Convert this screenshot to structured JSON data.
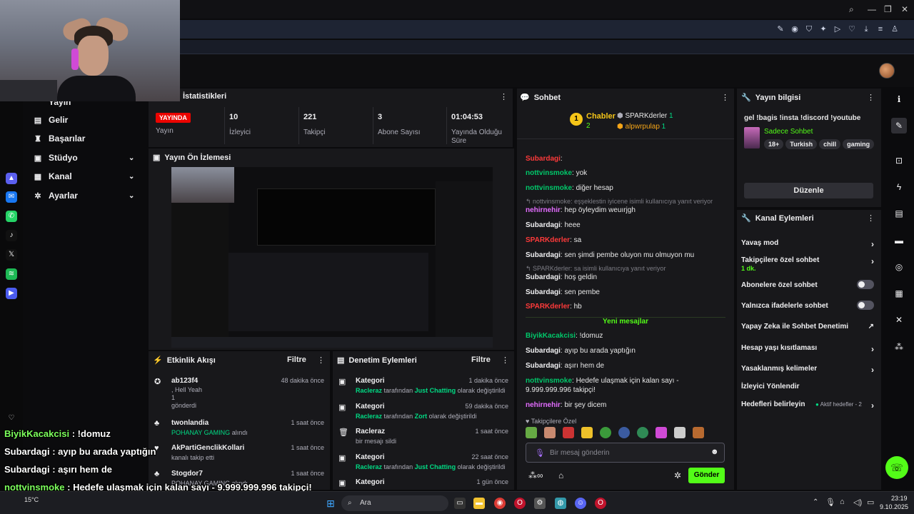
{
  "nav": {
    "current_partial": "Yayın",
    "items": [
      {
        "label": "Gelir",
        "icon": "dollar-icon",
        "chev": ""
      },
      {
        "label": "Başarılar",
        "icon": "trophy-icon",
        "chev": ""
      },
      {
        "label": "Stüdyo",
        "icon": "studio-icon",
        "chev": "⌄"
      },
      {
        "label": "Kanal",
        "icon": "channel-icon",
        "chev": "⌄"
      },
      {
        "label": "Ayarlar",
        "icon": "gear-icon",
        "chev": "⌄"
      }
    ]
  },
  "stats": {
    "title": "İstatistikleri",
    "live_badge": "YAYINDA",
    "live_label": "Yayın",
    "viewers": {
      "value": "10",
      "label": "İzleyici"
    },
    "followers": {
      "value": "221",
      "label": "Takipçi"
    },
    "subs": {
      "value": "3",
      "label": "Abone Sayısı"
    },
    "uptime": {
      "value": "01:04:53",
      "label": "Yayında Olduğu Süre"
    }
  },
  "preview": {
    "title": "Yayın Ön İzlemesi"
  },
  "activity": {
    "title": "Etkinlik Akışı",
    "filter": "Filtre",
    "items": [
      {
        "name": "ab123f4",
        "time": "48 dakika önce",
        "line1": ", Hell Yeah",
        "line2": "1",
        "line3": "gönderdi"
      },
      {
        "name": "twonlandia",
        "time": "1 saat önce",
        "line1": "POHANAY GAMING",
        "line2": "alındı"
      },
      {
        "name": "AkPartiGenclikKollari",
        "time": "1 saat önce",
        "line1": "kanalı takip etti"
      },
      {
        "name": "Stogdor7",
        "time": "1 saat önce",
        "line1": "POHANAY GAMING alındı"
      }
    ]
  },
  "mod": {
    "title": "Denetim Eylemleri",
    "filter": "Filtre",
    "items": [
      {
        "title": "Kategori",
        "time": "1 dakika önce",
        "who": "Racleraz",
        "mid": "tarafından",
        "what": "Just Chatting",
        "end": "olarak değiştirildi"
      },
      {
        "title": "Kategori",
        "time": "59 dakika önce",
        "who": "Racleraz",
        "mid": "tarafından",
        "what": "Zort",
        "end": "olarak değiştirildi"
      },
      {
        "title": "Racleraz",
        "time": "1 saat önce",
        "who": "",
        "mid": "bir mesajı sildi",
        "what": "",
        "end": ""
      },
      {
        "title": "Kategori",
        "time": "22 saat önce",
        "who": "Racleraz",
        "mid": "tarafından",
        "what": "Just Chatting",
        "end": "olarak değiştirildi"
      },
      {
        "title": "Kategori",
        "time": "1 gün önce",
        "who": "",
        "mid": "",
        "what": "",
        "end": ""
      }
    ]
  },
  "chat": {
    "title": "Sohbet",
    "leader": {
      "rank": "1",
      "name": "Chabler",
      "count": "2"
    },
    "top2": {
      "name": "SPARKderler",
      "count": "1"
    },
    "top3": {
      "name": "alpwrpulap",
      "count": "1"
    },
    "new_messages": "Yeni mesajlar",
    "follower_only": "Takipçilere Özel",
    "input_placeholder": "Bir mesaj gönderin",
    "send": "Gönder",
    "lines": [
      {
        "user": "Subardagi",
        "sep": ":",
        "text": "",
        "cls": "u-red"
      },
      {
        "user": "nottvinsmoke",
        "sep": ":",
        "text": "yok",
        "cls": "u-green"
      },
      {
        "user": "nottvinsmoke",
        "sep": ":",
        "text": "diğer hesap",
        "cls": "u-green"
      },
      {
        "reply": "↰ nottvinsmoke: eşşeklestin iyicene isimli kullanıcıya yanıt veriyor"
      },
      {
        "user": "nehirnehir",
        "sep": ":",
        "text": "hep öyleydim weuırjgh",
        "cls": "u-pink"
      },
      {
        "user": "Subardagi",
        "sep": ":",
        "text": "heee",
        "cls": "u-white"
      },
      {
        "user": "SPARKderler",
        "sep": ":",
        "text": "sa",
        "cls": "u-red"
      },
      {
        "user": "Subardagi",
        "sep": ":",
        "text": "sen şimdi pembe oluyon mu olmuyon mu",
        "cls": "u-white"
      },
      {
        "reply": "↰ SPARKderler: sa isimli kullanıcıya yanıt veriyor"
      },
      {
        "user": "Subardagi",
        "sep": ":",
        "text": "hoş geldin",
        "cls": "u-white"
      },
      {
        "user": "Subardagi",
        "sep": ":",
        "text": "sen pembe",
        "cls": "u-white"
      },
      {
        "user": "SPARKderler",
        "sep": ":",
        "text": "hb",
        "cls": "u-red"
      }
    ],
    "new_lines": [
      {
        "user": "BiyikKacakcisi",
        "sep": ":",
        "text": "!domuz",
        "cls": "u-green"
      },
      {
        "user": "Subardagi",
        "sep": ":",
        "text": "ayıp bu arada yaptığın",
        "cls": "u-white"
      },
      {
        "user": "Subardagi",
        "sep": ":",
        "text": "aşırı hem de",
        "cls": "u-white"
      },
      {
        "user": "nottvinsmoke",
        "sep": ":",
        "text": "Hedefe ulaşmak için kalan sayı - 9.999.999.996 takipçi!",
        "cls": "u-green"
      },
      {
        "user": "nehirnehir",
        "sep": ":",
        "text": "bir şey dicem",
        "cls": "u-pink"
      }
    ]
  },
  "streaminfo": {
    "title": "Yayın bilgisi",
    "stream_title": "gel !bagis !insta !discord !youtube",
    "category": "Sadece Sohbet",
    "tags": [
      "18+",
      "Turkish",
      "chill",
      "gaming"
    ],
    "edit": "Düzenle"
  },
  "chanactions": {
    "title": "Kanal Eylemleri",
    "slow": "Yavaş mod",
    "follower_chat": "Takipçilere özel sohbet",
    "follower_chat_sub": "1 dk.",
    "sub_chat": "Abonelere özel sohbet",
    "emote_chat": "Yalnızca ifadelerle sohbet",
    "ai_mod": "Yapay Zeka ile Sohbet Denetimi",
    "age": "Hesap yaşı kısıtlaması",
    "banned_words": "Yasaklanmış kelimeler",
    "raid": "İzleyici Yönlendir",
    "goals": "Hedefleri belirleyin",
    "goals_status": "Aktif hedefler - 2"
  },
  "overlay": [
    {
      "user": "BiyikKacakcisi",
      "text": " : !domuz",
      "color": "#7cff5c"
    },
    {
      "user": "Subardagi",
      "text": " : ayıp bu arada yaptığın",
      "color": "#ffffff"
    },
    {
      "user": "Subardagi",
      "text": " : aşırı hem de",
      "color": "#ffffff"
    },
    {
      "user": "nottvinsmoke",
      "text": " : Hedefe ulaşmak için kalan sayı - 9.999.999.996 takipçi!",
      "color": "#7cff5c"
    },
    {
      "user": "nehirnehir",
      "text": " : bir şey dicem",
      "color": "#e36cff"
    }
  ],
  "taskbar": {
    "search": "Ara",
    "time": "23:19",
    "date": "9.10.2025",
    "temp": "15°C"
  },
  "colors": {
    "accent": "#53fc18",
    "live": "#eb0400",
    "panel": "#18181b"
  }
}
